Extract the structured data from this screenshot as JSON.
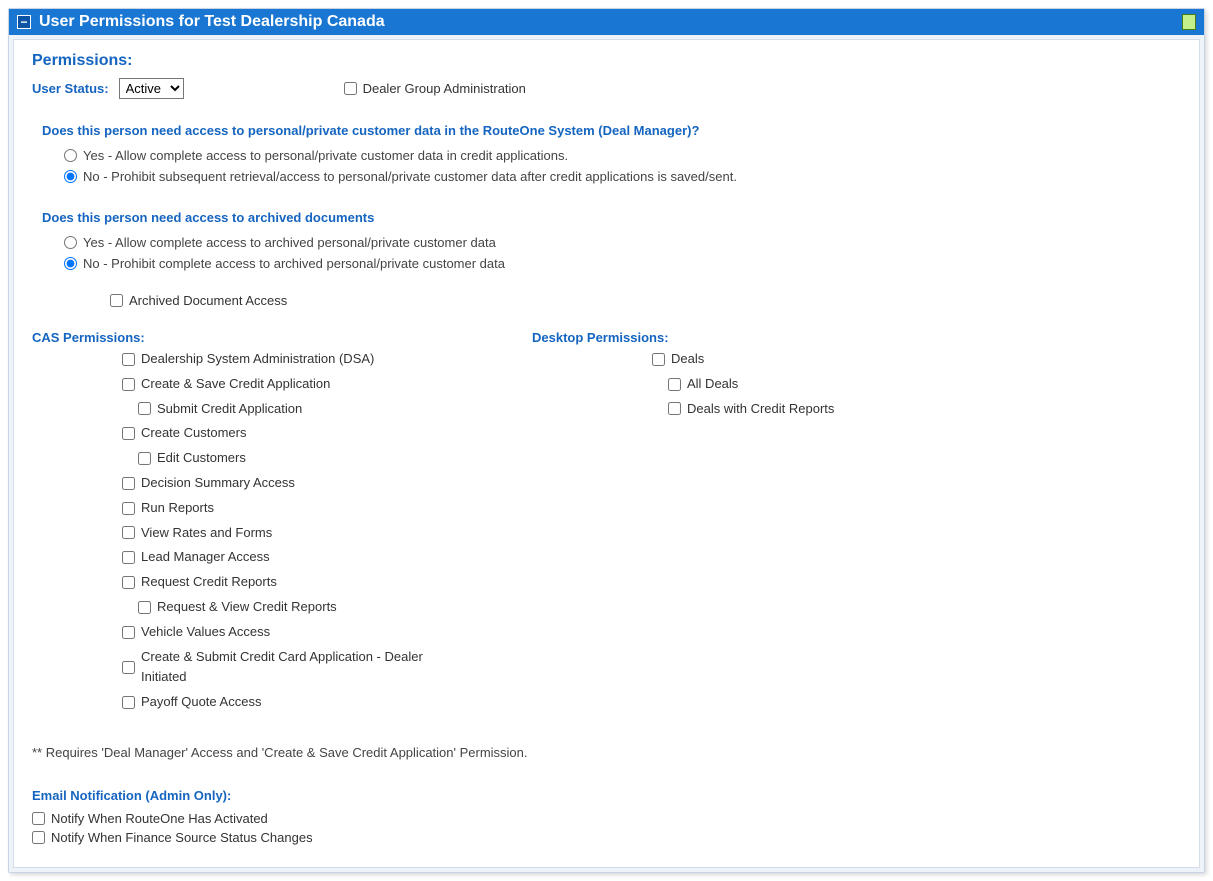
{
  "header": {
    "title": "User Permissions for Test Dealership Canada"
  },
  "permissions": {
    "title": "Permissions:",
    "user_status_label": "User Status:",
    "user_status_value": "Active",
    "dealer_group_admin": "Dealer Group Administration"
  },
  "q1": {
    "question": "Does this person need access to personal/private customer data in the RouteOne System (Deal Manager)?",
    "yes": "Yes - Allow complete access to personal/private customer data in credit applications.",
    "no": "No - Prohibit subsequent retrieval/access to personal/private customer data after credit applications is saved/sent."
  },
  "q2": {
    "question": "Does this person need access to archived documents",
    "yes": "Yes - Allow complete access to archived personal/private customer data",
    "no": "No - Prohibit complete access to archived personal/private customer data",
    "archived_access": "Archived Document Access"
  },
  "cas": {
    "title": "CAS Permissions:",
    "dsa": "Dealership System Administration (DSA)",
    "create_save": "Create & Save Credit Application",
    "submit": "Submit Credit Application",
    "create_customers": "Create Customers",
    "edit_customers": "Edit Customers",
    "decision_summary": "Decision Summary Access",
    "run_reports": "Run Reports",
    "view_rates": "View Rates and Forms",
    "lead_manager": "Lead Manager Access",
    "request_credit": "Request Credit Reports",
    "request_view_credit": "Request & View Credit Reports",
    "vehicle_values": "Vehicle Values Access",
    "create_submit_cc": "Create & Submit Credit Card Application - Dealer Initiated",
    "payoff_quote": "Payoff Quote Access"
  },
  "desktop": {
    "title": "Desktop Permissions:",
    "deals": "Deals",
    "all_deals": "All Deals",
    "deals_credit": "Deals with Credit Reports"
  },
  "footnote": "** Requires 'Deal Manager' Access and 'Create & Save Credit Application' Permission.",
  "email": {
    "title": "Email Notification (Admin Only):",
    "notify_activated": "Notify When RouteOne Has Activated",
    "notify_finance": "Notify When Finance Source Status Changes"
  }
}
